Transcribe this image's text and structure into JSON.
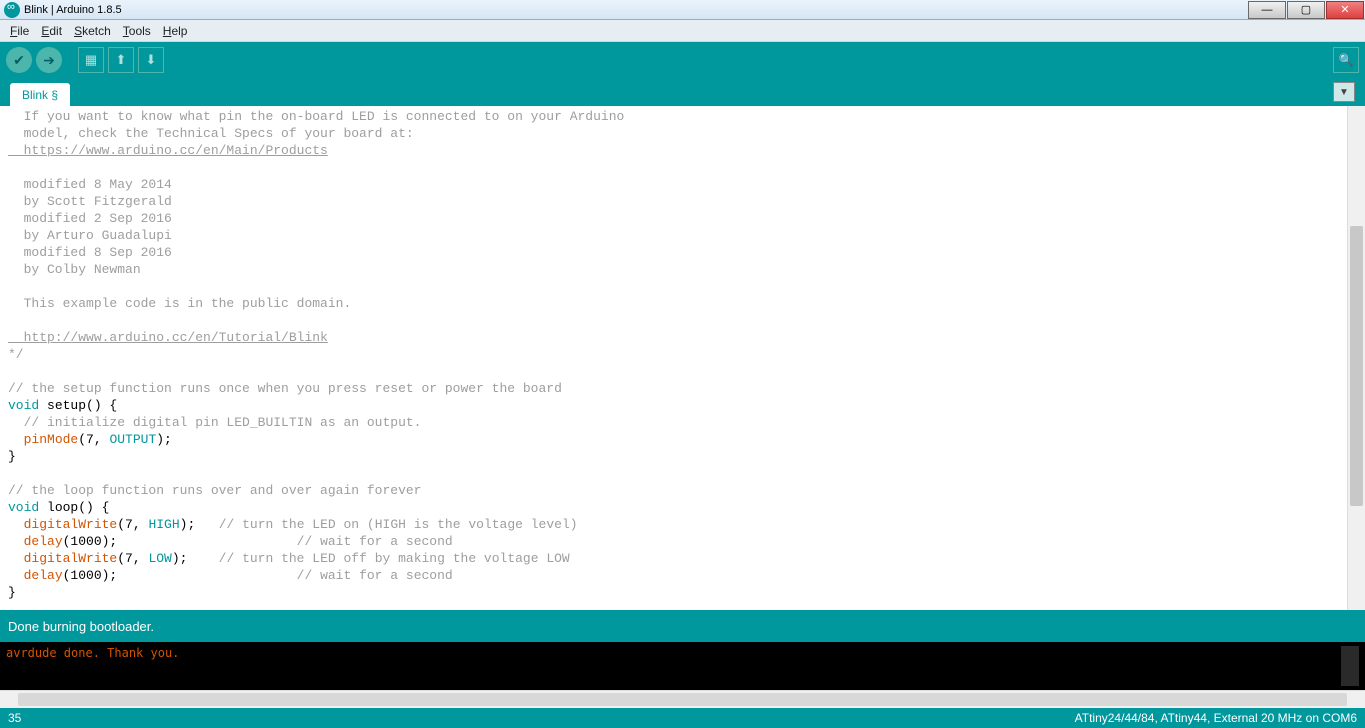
{
  "window": {
    "title": "Blink | Arduino 1.8.5"
  },
  "menu": {
    "file": "File",
    "edit": "Edit",
    "sketch": "Sketch",
    "tools": "Tools",
    "help": "Help"
  },
  "tab": {
    "name": "Blink §"
  },
  "code": {
    "l1": "  If you want to know what pin the on-board LED is connected to on your Arduino",
    "l2": "  model, check the Technical Specs of your board at:",
    "l3": "  https://www.arduino.cc/en/Main/Products",
    "l4": "",
    "l5": "  modified 8 May 2014",
    "l6": "  by Scott Fitzgerald",
    "l7": "  modified 2 Sep 2016",
    "l8": "  by Arturo Guadalupi",
    "l9": "  modified 8 Sep 2016",
    "l10": "  by Colby Newman",
    "l11": "",
    "l12": "  This example code is in the public domain.",
    "l13": "",
    "l14": "  http://www.arduino.cc/en/Tutorial/Blink",
    "l15": "*/",
    "l16": "",
    "l17": "// the setup function runs once when you press reset or power the board",
    "void": "void",
    "setup": " setup",
    "setup_paren": "() {",
    "l19": "  // initialize digital pin LED_BUILTIN as an output.",
    "pinMode": "pinMode",
    "pinMode_args_a": "(7, ",
    "OUTPUT": "OUTPUT",
    "pinMode_args_b": ");",
    "rbrace": "}",
    "l22": "",
    "l23": "// the loop function runs over and over again forever",
    "loop": " loop",
    "loop_paren": "() {",
    "dw": "digitalWrite",
    "dw1a": "(7, ",
    "HIGH": "HIGH",
    "dw1b": ");   ",
    "dw1c": "// turn the LED on (HIGH is the voltage level)",
    "delay": "delay",
    "delay1a": "(1000);                       ",
    "delay1c": "// wait for a second",
    "dw2a": "(7, ",
    "LOW": "LOW",
    "dw2b": ");    ",
    "dw2c": "// turn the LED off by making the voltage LOW",
    "delay2a": "(1000);                       ",
    "delay2c": "// wait for a second",
    "indent": "  "
  },
  "status": {
    "message": "Done burning bootloader."
  },
  "console": {
    "line": "avrdude done.  Thank you."
  },
  "footer": {
    "line": "35",
    "board": "ATtiny24/44/84, ATtiny44, External 20 MHz on COM6"
  }
}
